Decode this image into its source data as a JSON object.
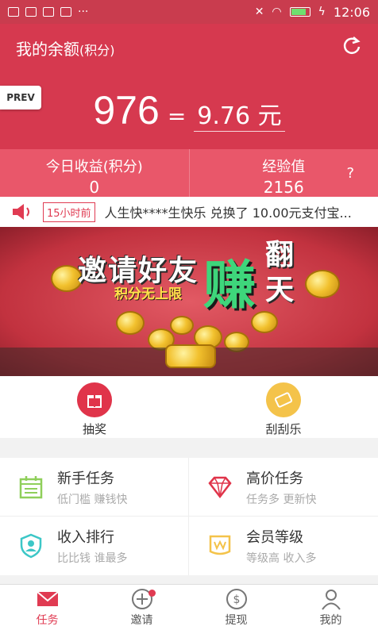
{
  "status_bar": {
    "time": "12:06"
  },
  "header": {
    "title": "我的余额",
    "title_suffix": "(积分)"
  },
  "prev_label": "PREV",
  "balance": {
    "points": "976",
    "equals": "=",
    "money": "9.76 元"
  },
  "stats": [
    {
      "label": "今日收益(积分)",
      "value": "0"
    },
    {
      "label": "经验值",
      "value": "2156"
    }
  ],
  "help_mark": "?",
  "ticker": {
    "time_badge": "15小时前",
    "text": "人生快****生快乐 兑换了 10.00元支付宝..."
  },
  "banner": {
    "title": "邀请好友",
    "subtitle": "积分无上限",
    "big": "赚",
    "side": "翻天"
  },
  "quick_actions": [
    {
      "label": "抽奖",
      "icon": "gift-icon",
      "color": "#e0344a"
    },
    {
      "label": "刮刮乐",
      "icon": "ticket-icon",
      "color": "#f4c34a"
    }
  ],
  "tasks": [
    {
      "title": "新手任务",
      "subtitle": "低门槛 赚钱快",
      "icon": "calendar-icon",
      "color": "#8fcf5a"
    },
    {
      "title": "高价任务",
      "subtitle": "任务多 更新快",
      "icon": "diamond-icon",
      "color": "#e0344a"
    },
    {
      "title": "收入排行",
      "subtitle": "比比钱 谁最多",
      "icon": "shield-icon",
      "color": "#3cc7c7"
    },
    {
      "title": "会员等级",
      "subtitle": "等级高 收入多",
      "icon": "level-icon",
      "color": "#f4c34a"
    }
  ],
  "nav": [
    {
      "label": "任务",
      "icon": "mail-icon",
      "active": true
    },
    {
      "label": "邀请",
      "icon": "plus-circle-icon",
      "badge": true
    },
    {
      "label": "提现",
      "icon": "dollar-icon"
    },
    {
      "label": "我的",
      "icon": "user-icon"
    }
  ],
  "colors": {
    "primary": "#d6394f",
    "accent": "#e03b52"
  }
}
